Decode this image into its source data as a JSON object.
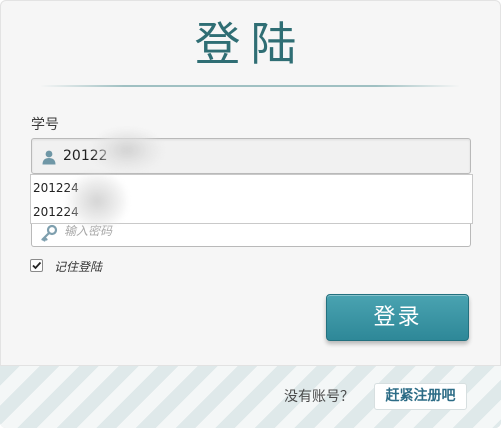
{
  "header": {
    "title": "登陆"
  },
  "username": {
    "label": "学号",
    "value": "20122",
    "icon": "user-icon"
  },
  "autocomplete": {
    "items": [
      "201224",
      "201224"
    ]
  },
  "password": {
    "placeholder": "输入密码",
    "icon": "key-icon"
  },
  "remember": {
    "label": "记住登陆",
    "checked": true
  },
  "login": {
    "label": "登录"
  },
  "footer": {
    "prompt": "没有账号？",
    "register_label": "赶紧注册吧"
  },
  "colors": {
    "accent": "#3a97a6",
    "title": "#2f6e74",
    "link": "#2c6c86"
  }
}
